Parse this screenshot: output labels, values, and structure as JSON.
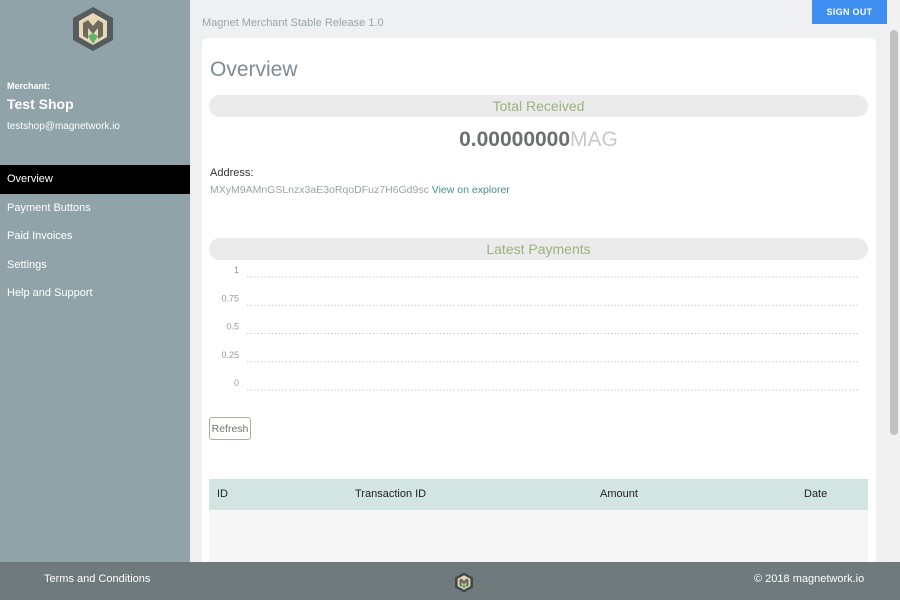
{
  "sidebar": {
    "merchant_label": "Merchant:",
    "merchant_name": "Test Shop",
    "merchant_email": "testshop@magnetwork.io",
    "nav": [
      {
        "label": "Overview",
        "active": true
      },
      {
        "label": "Payment Buttons",
        "active": false
      },
      {
        "label": "Paid Invoices",
        "active": false
      },
      {
        "label": "Settings",
        "active": false
      },
      {
        "label": "Help and Support",
        "active": false
      }
    ]
  },
  "header": {
    "release": "Magnet Merchant Stable Release 1.0",
    "signout_label": "SIGN OUT"
  },
  "main": {
    "title": "Overview",
    "total_received_heading": "Total Received",
    "total_value": "0.00000000",
    "total_unit": "MAG",
    "address_label": "Address:",
    "address": "MXyM9AMnGSLnzx3aE3oRqoDFuz7H6Gd9sc",
    "explorer_link": "View on explorer",
    "latest_payments_heading": "Latest Payments",
    "refresh_label": "Refresh",
    "table_headers": [
      "ID",
      "Transaction ID",
      "Amount",
      "Date"
    ]
  },
  "chart_data": {
    "type": "line",
    "series": [],
    "y_ticks": [
      "1",
      "0.75",
      "0.5",
      "0.25",
      "0"
    ],
    "ylim": [
      0,
      1
    ],
    "grid": true
  },
  "footer": {
    "terms": "Terms and Conditions",
    "copyright": "© 2018 magnetwork.io"
  },
  "colors": {
    "sidebar": "#8fa3a8",
    "active_nav": "#000000",
    "signout": "#3d8ef0",
    "accent_green": "#9bb27a",
    "link": "#4a8d8d",
    "footer": "#6e7a7c"
  }
}
